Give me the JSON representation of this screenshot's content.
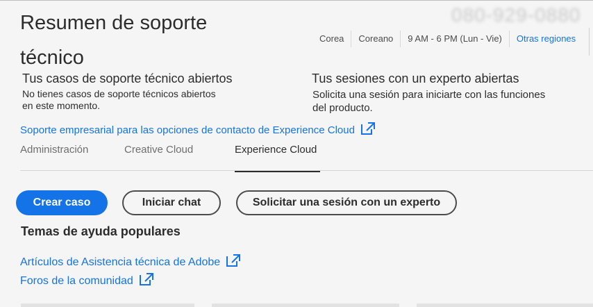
{
  "header": {
    "title": "Resumen de soporte técnico",
    "phone": "080-929-0880",
    "meta": {
      "country": "Corea",
      "language": "Coreano",
      "hours": "9 AM - 6 PM (Lun - Vie)",
      "other_regions": "Otras regiones"
    }
  },
  "open_cases": {
    "title": "Tus casos de soporte técnico abiertos",
    "text_line1": "No tienes casos de soporte técnicos abiertos",
    "text_line2": "en este momento."
  },
  "open_sessions": {
    "title": "Tus sesiones con un experto abiertas",
    "text_line1": "Solicita una sesión para iniciarte con las funciones",
    "text_line2": "del producto."
  },
  "enterprise_link": "Soporte empresarial para las opciones de contacto de Experience Cloud",
  "tabs": [
    {
      "label": "Administración",
      "active": false
    },
    {
      "label": "Creative Cloud",
      "active": false
    },
    {
      "label": "Experience Cloud",
      "active": true
    }
  ],
  "actions": {
    "create_case": "Crear caso",
    "start_chat": "Iniciar chat",
    "request_session": "Solicitar una sesión con un experto"
  },
  "help": {
    "title": "Temas de ayuda populares",
    "links": [
      {
        "label": "Artículos de Asistencia técnica de Adobe"
      },
      {
        "label": "Foros de la comunidad"
      }
    ]
  },
  "colors": {
    "accent": "#1473e6",
    "text": "#2c2c2c",
    "background": "#f5f5f5"
  },
  "icons": {
    "external_link": "external-link-icon"
  }
}
